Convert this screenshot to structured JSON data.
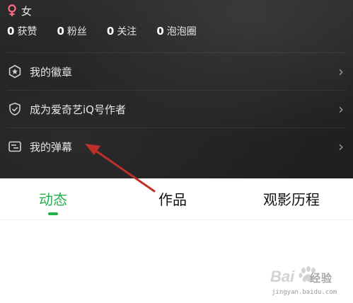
{
  "profile": {
    "gender_label": "女",
    "gender_color": "#ff6b81"
  },
  "stats": [
    {
      "value": "0",
      "label": "获赞"
    },
    {
      "value": "0",
      "label": "粉丝"
    },
    {
      "value": "0",
      "label": "关注"
    },
    {
      "value": "0",
      "label": "泡泡圈"
    }
  ],
  "menu": [
    {
      "label": "我的徽章",
      "icon": "badge-icon"
    },
    {
      "label": "成为爱奇艺iQ号作者",
      "icon": "shield-check-icon"
    },
    {
      "label": "我的弹幕",
      "icon": "danmaku-icon"
    }
  ],
  "tabs": [
    {
      "label": "动态",
      "active": true
    },
    {
      "label": "作品",
      "active": false
    },
    {
      "label": "观影历程",
      "active": false
    }
  ],
  "accent_color": "#22b14c",
  "annotation_arrow_color": "#c0302a",
  "watermark": {
    "brand": "Bai",
    "brand_cn": "经验",
    "url": "jingyan.baidu.com"
  }
}
